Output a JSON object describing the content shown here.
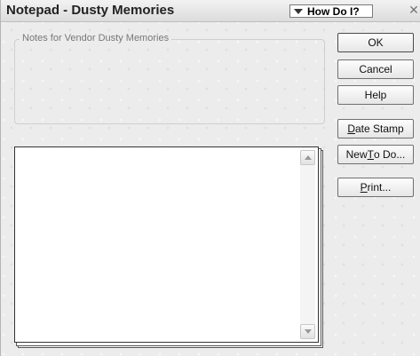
{
  "window": {
    "title": "Notepad - Dusty Memories",
    "how_do_i": "How Do I?",
    "close_glyph": "✕"
  },
  "notes_group": {
    "label": "Notes for Vendor Dusty Memories"
  },
  "buttons": {
    "ok": "OK",
    "cancel": "Cancel",
    "help": "Help",
    "date_stamp": {
      "pre": "",
      "accel": "D",
      "post": "ate Stamp"
    },
    "new_todo": {
      "pre": "New ",
      "accel": "T",
      "post": "o Do..."
    },
    "print": {
      "pre": "",
      "accel": "P",
      "post": "rint..."
    }
  },
  "editor": {
    "value": ""
  }
}
